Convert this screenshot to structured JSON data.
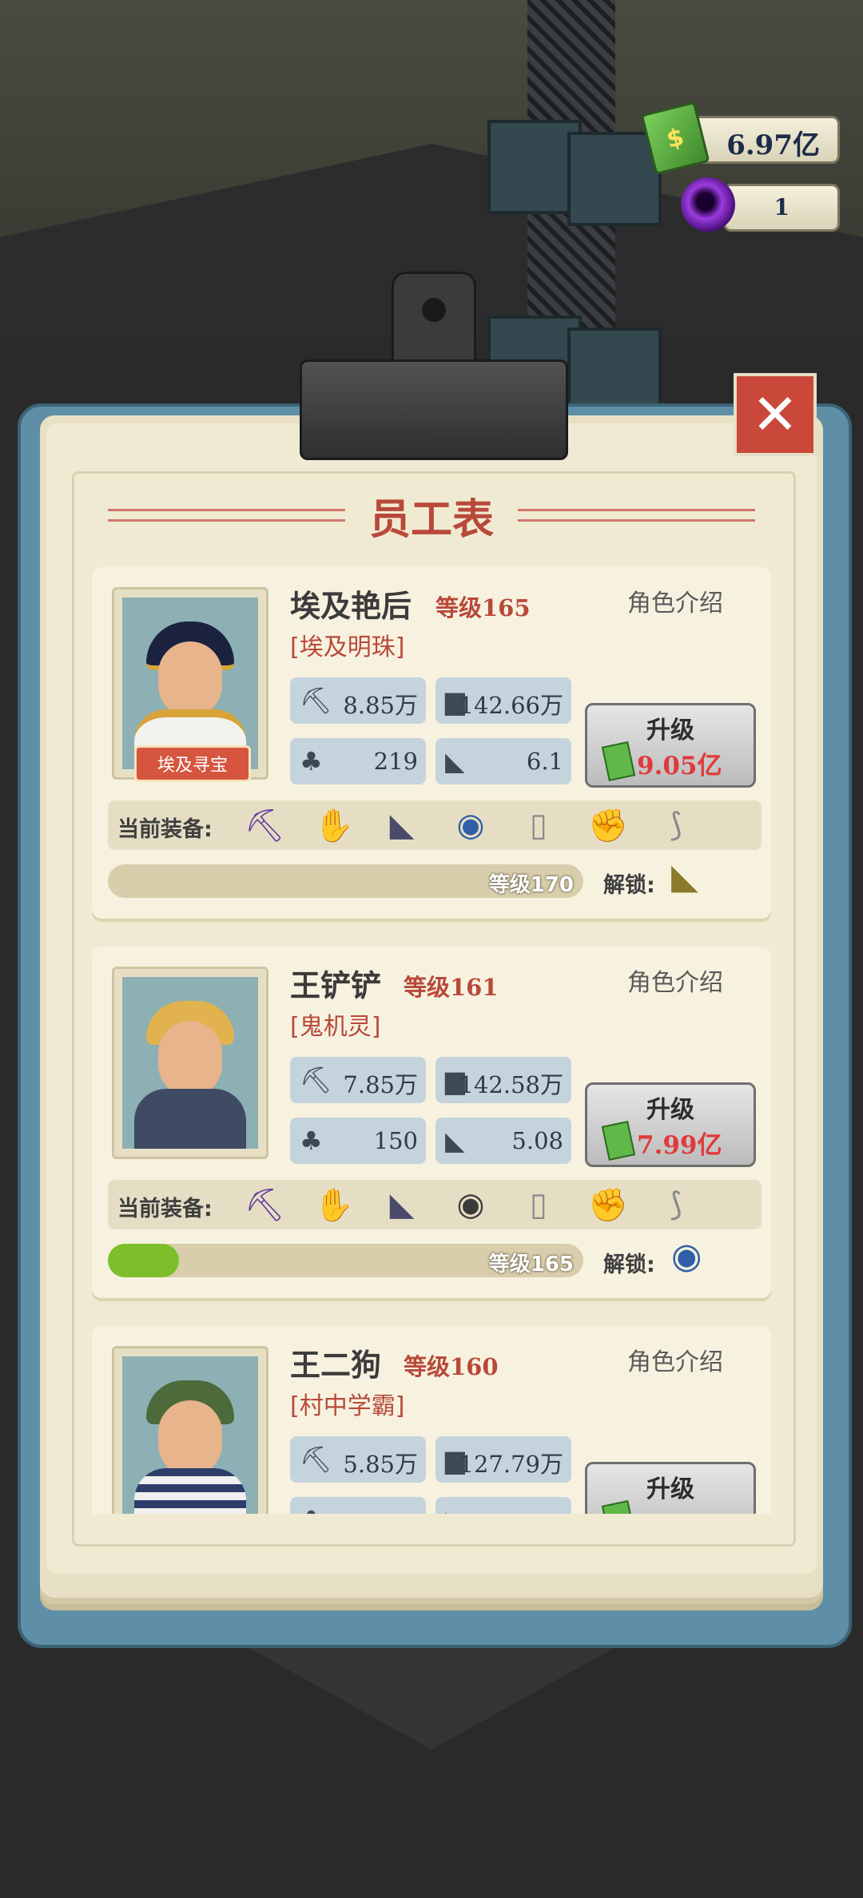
{
  "currency": {
    "money": "6.97亿",
    "gems": "1"
  },
  "dialog": {
    "title": "员工表",
    "close": "✕",
    "intro_label": "角色介绍",
    "equip_label": "当前装备:",
    "unlock_label": "解锁:",
    "upgrade_label": "升级"
  },
  "employees": [
    {
      "name": "埃及艳后",
      "level": "等级165",
      "title": "[埃及明珠]",
      "badge": "埃及寻宝",
      "pick": "8.85万",
      "cart": "142.66万",
      "luck": "219",
      "speed": "6.1",
      "upgrade_cost": "9.05亿",
      "next_level": "等级170",
      "progress": 0
    },
    {
      "name": "王铲铲",
      "level": "等级161",
      "title": "[鬼机灵]",
      "pick": "7.85万",
      "cart": "142.58万",
      "luck": "150",
      "speed": "5.08",
      "upgrade_cost": "7.99亿",
      "next_level": "等级165",
      "progress": 0.15
    },
    {
      "name": "王二狗",
      "level": "等级160",
      "title": "[村中学霸]",
      "pick": "5.85万",
      "cart": "127.79万"
    }
  ],
  "equipment_icons": [
    "pickaxe-icon",
    "glove-icon",
    "boot-icon",
    "headlamp-icon",
    "backpack-icon",
    "arm-guard-icon",
    "leg-guard-icon"
  ],
  "colors": {
    "accent_red": "#b8493a",
    "progress_green": "#7cbf2a",
    "stat_bg": "#c5d3dc"
  }
}
